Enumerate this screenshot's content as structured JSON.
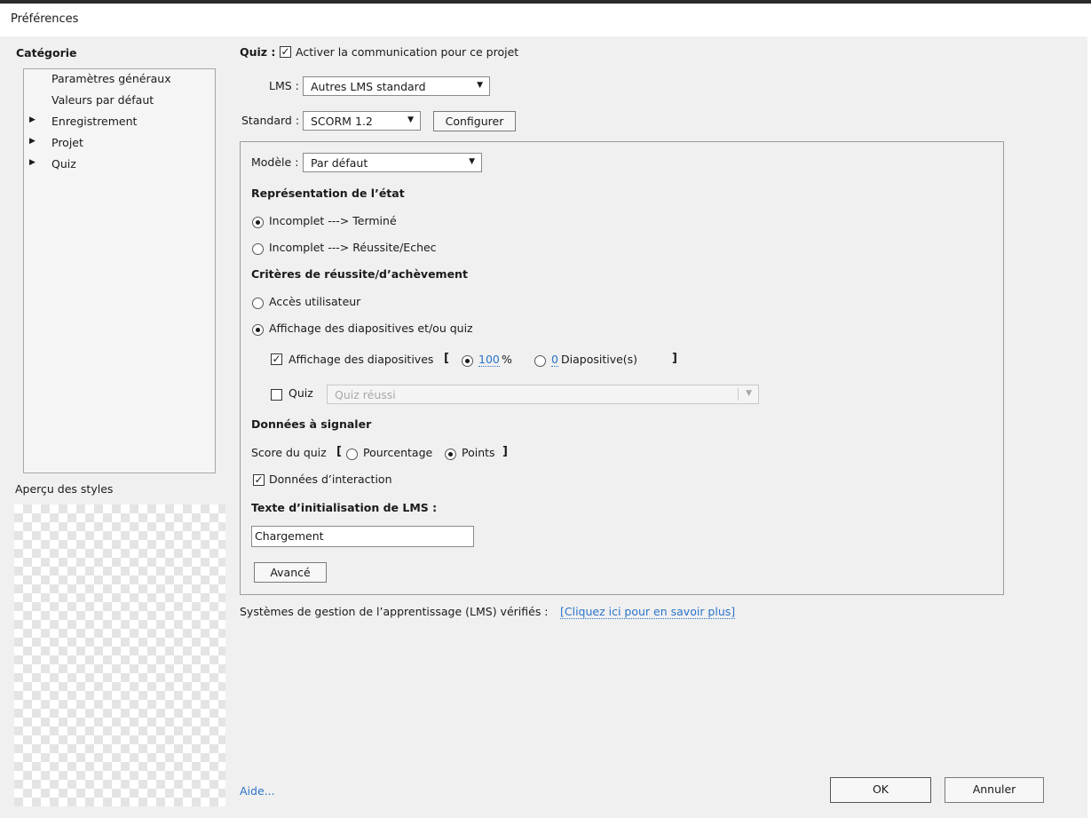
{
  "window": {
    "title": "Préférences"
  },
  "sidebar": {
    "heading": "Catégorie",
    "items": [
      {
        "label": "Paramètres généraux",
        "expandable": false
      },
      {
        "label": "Valeurs par défaut",
        "expandable": false
      },
      {
        "label": "Enregistrement",
        "expandable": true
      },
      {
        "label": "Projet",
        "expandable": true
      },
      {
        "label": "Quiz",
        "expandable": true
      }
    ],
    "preview_label": "Aperçu des styles"
  },
  "quiz": {
    "label": "Quiz :",
    "enable_label": "Activer la communication pour ce projet",
    "enable_checked": true,
    "lms_label": "LMS :",
    "lms_value": "Autres LMS standard",
    "standard_label": "Standard :",
    "standard_value": "SCORM 1.2",
    "configure_button": "Configurer"
  },
  "panel": {
    "template_label": "Modèle :",
    "template_value": "Par défaut",
    "status_heading": "Représentation de l’état",
    "status_options": [
      {
        "label": "Incomplet ---> Terminé",
        "selected": true
      },
      {
        "label": "Incomplet ---> Réussite/Echec",
        "selected": false
      }
    ],
    "criteria_heading": "Critères de réussite/d’achèvement",
    "criteria_options": [
      {
        "label": "Accès utilisateur",
        "selected": false
      },
      {
        "label": "Affichage des diapositives et/ou quiz",
        "selected": true
      }
    ],
    "slide_view": {
      "label": "Affichage des diapositives",
      "checked": true,
      "open_bracket": "[",
      "percent_value": "100",
      "percent_unit": "%",
      "percent_selected": true,
      "slides_value": "0",
      "slides_unit": "Diapositive(s)",
      "slides_selected": false,
      "close_bracket": "]"
    },
    "quiz_criteria": {
      "label": "Quiz",
      "checked": false,
      "select_value": "Quiz réussi"
    },
    "report_heading": "Données à signaler",
    "score": {
      "label": "Score du quiz",
      "open_bracket": "[",
      "options": [
        {
          "label": "Pourcentage",
          "selected": false
        },
        {
          "label": "Points",
          "selected": true
        }
      ],
      "close_bracket": "]"
    },
    "interaction_data": {
      "label": "Données d’interaction",
      "checked": true
    },
    "init_text_heading": "Texte d’initialisation de LMS :",
    "init_text_value": "Chargement",
    "advanced_button": "Avancé"
  },
  "footer": {
    "lms_info_label": "Systèmes de gestion de l’apprentissage (LMS) vérifiés :",
    "lms_info_link": "[Cliquez ici pour en savoir plus]",
    "help_link": "Aide...",
    "ok_button": "OK",
    "cancel_button": "Annuler"
  }
}
